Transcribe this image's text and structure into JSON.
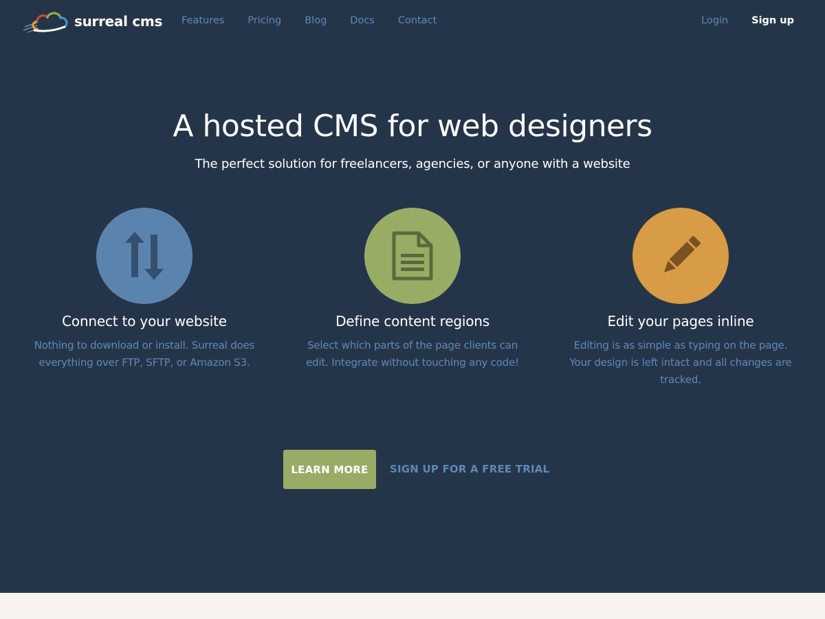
{
  "brand": {
    "name": "surreal cms",
    "logo_icon": "cloud-logo-icon"
  },
  "nav": {
    "items": [
      {
        "label": "Features"
      },
      {
        "label": "Pricing"
      },
      {
        "label": "Blog"
      },
      {
        "label": "Docs"
      },
      {
        "label": "Contact"
      }
    ],
    "login_label": "Login",
    "signup_label": "Sign up"
  },
  "hero": {
    "title": "A hosted CMS for web designers",
    "subtitle": "The perfect solution for freelancers, agencies, or anyone with a website"
  },
  "features": [
    {
      "icon": "up-down-arrows-icon",
      "title": "Connect to your website",
      "description": "Nothing to download or install. Surreal does everything over FTP, SFTP, or Amazon S3.",
      "color": "#5a84ae"
    },
    {
      "icon": "document-icon",
      "title": "Define content regions",
      "description": "Select which parts of the page clients can edit. Integrate without touching any code!",
      "color": "#98ac66"
    },
    {
      "icon": "pencil-icon",
      "title": "Edit your pages inline",
      "description": "Editing is as simple as typing on the page. Your design is left intact and all changes are tracked.",
      "color": "#d79c45"
    }
  ],
  "cta": {
    "learn_more_label": "LEARN MORE",
    "trial_label": "SIGN UP FOR A FREE TRIAL"
  },
  "colors": {
    "background": "#253549",
    "link": "#5d88b8",
    "footer": "#f6f3ee"
  }
}
